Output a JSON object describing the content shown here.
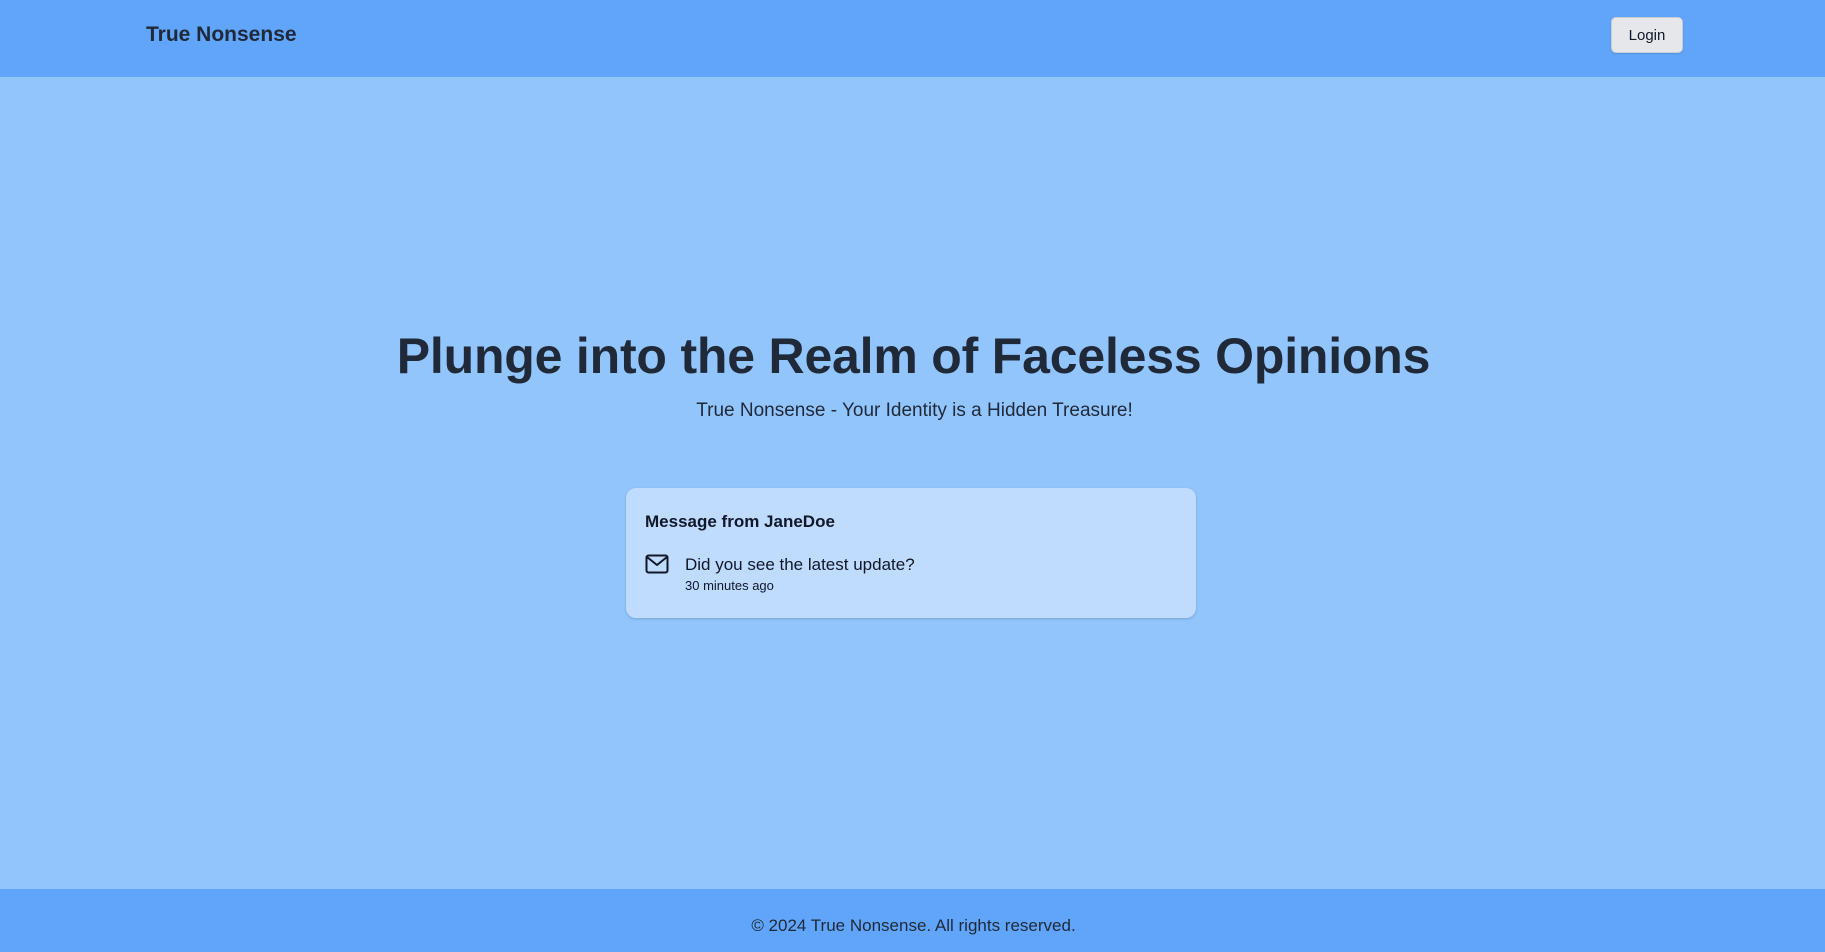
{
  "header": {
    "brand": "True Nonsense",
    "login_label": "Login"
  },
  "hero": {
    "title": "Plunge into the Realm of Faceless Opinions",
    "subtitle": "True Nonsense - Your Identity is a Hidden Treasure!"
  },
  "message_card": {
    "title": "Message from JaneDoe",
    "icon": "mail-icon",
    "text": "Did you see the latest update?",
    "time": "30 minutes ago"
  },
  "footer": {
    "text": "© 2024 True Nonsense. All rights reserved."
  },
  "colors": {
    "page_bg": "#93c5fd",
    "header_bg": "#60a5fa",
    "card_bg": "#bfdbfe",
    "text": "#1f2937"
  }
}
